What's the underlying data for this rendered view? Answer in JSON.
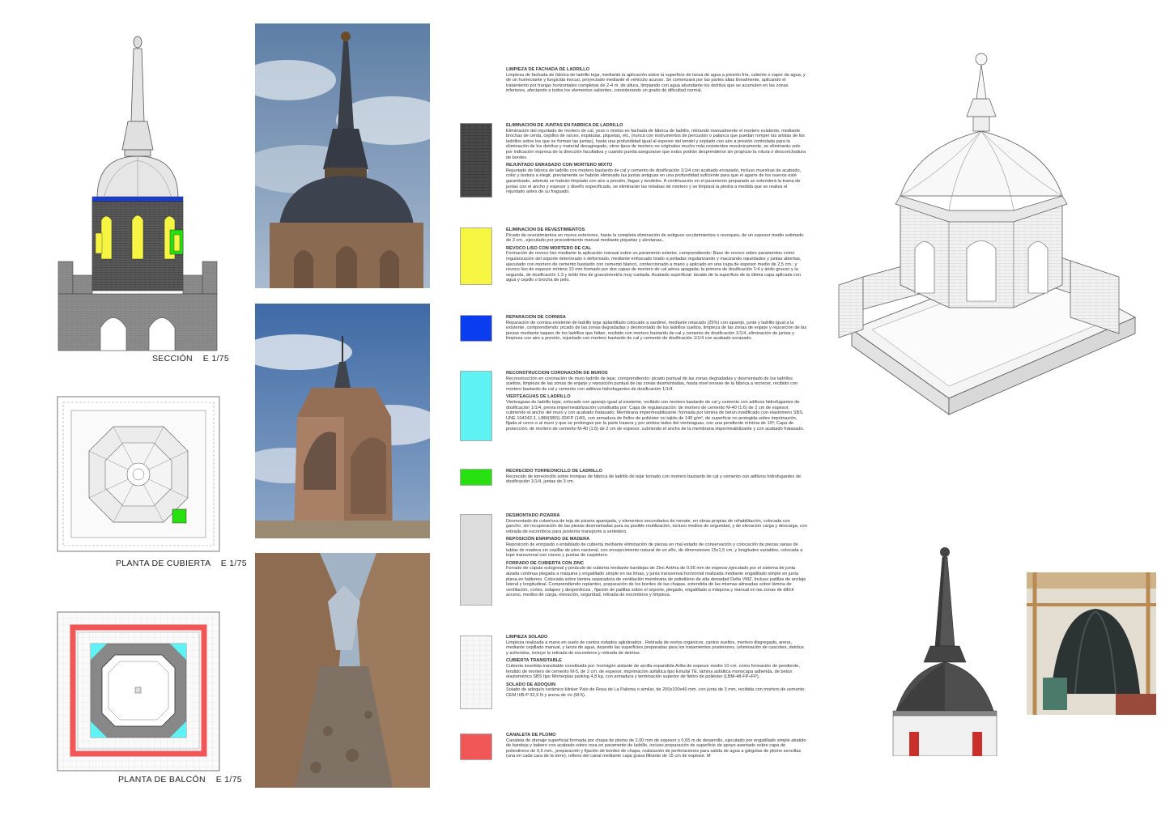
{
  "drawings": {
    "section_label": "SECCIÓN    E 1/75",
    "roof_plan_label": "PLANTA DE CUBIERTA    E 1/75",
    "balcony_plan_label": "PLANTA DE BALCÓN    E 1/75"
  },
  "legend": [
    {
      "swatch_color": "#4a4a4a",
      "swatch_pattern": "brick-dark",
      "entries": [
        {
          "title": "LIMPIEZA DE FACHADA DE LADRILLO",
          "text": "Limpieza de fachada de fábrica de ladrillo tejar, mediante la aplicación sobre la superficie de lanza de agua a presión fría, caliente o vapor de agua, y de un humectante y fungicida inocuo, proyectado mediante el vehículo acuoso. Se comenzará por las partes altas linealmente, aplicando el tratamiento por franjas horizontales completas de 2-4 m. de altura, limpiando con agua abundante los detritus que se acumulen en las zonas inferiores, afectando a todos los elementos salientes, considerando un grado de dificultad normal."
        },
        {
          "title": "ELIMINACION DE JUNTAS EN FABRICA DE LADRILLO",
          "text": "Eliminación del rejuntado de mortero de cal, yeso o mixtos en fachada de fábrica de ladrillo, retirando manualmente el mortero existente, mediante brochas de cerda, cepillos de raíces, espátulas, piquetas, etc, (nunca con instrumentos de percusión o palanca que puedan romper las aristas de los ladrillos sobre los que se forman las juntas), hasta una profundidad igual al espesor del tendel y soplado con aire a presión controlada para la eliminación de los detritus y material desagregado, otros tipos de mortero no originales mucho más resistentes mecánicamente, se eliminarán solo por indicación expresa de la dirección facultativa y cuando pueda asegurarse que estos podrán desprenderse sin propiciar la rotura o desconchadura de bordes."
        },
        {
          "title": "REJUNTADO ENRASADO CON MORTERO MIXTO",
          "text": "Rejuntado de fábrica de ladrillo con mortero bastardo de cal y cemento de dosificación 1/1/4 con acabado enrasado, incluso muestras de acabado, color y textura a elegir, previamente se habrán eliminado las juntas antiguas en una profundidad suficiente para que el agarre de los nuevos esté garantizado, además se habrán limpiado con aire a presión, llagas y tendeles. A continuación en el paramento preparado se extenderá la trama de juntas con el ancho y espesor y diseño especificado, se eliminarán las rebabas de mortero y se limpiará la piedra a medida que se realiza el rejuntado antes de su fraguado."
        }
      ]
    },
    {
      "swatch_color": "#f5f542",
      "swatch_pattern": "solid",
      "entries": [
        {
          "title": "ELIMINACION DE REVESTIMIENTOS",
          "text": "Picado de revestimientos en muros exteriores, hasta la completa eliminación de antiguos recubrimientos o revoques, de un espesor medio estimado de 3 cm., ejecutado por procedimiento manual mediante piquetas y alcotanas,."
        },
        {
          "title": "REVOCO LISO CON MORTERO DE CAL",
          "text": "Formación de revoco liso mediante la aplicación manual sobre un paramento exterior, comprendiendo: Base de revoco sobre paramentos como regularización del soporte deteriorado o deformado, mediante enfoscado tirado a pelladas regularizando y macizando oquedades y juntas abiertas, ejecutado con mortero de cemento bastardo con cemento blanco, confeccionado a mano y aplicado en una capa de espesor medio de 2,5 cm.; y revoco liso de espesor mínimo 10 mm formado por dos capas de mortero de cal aérea apagada; la primera de dosificación 1:4 y árido grueso y la segunda, de dosificación 1:3 y árido fino de granulometría muy cuidada. Acabado superficial: lavado de la superficie de la última capa aplicada con agua y cepillo o brocha de pelo."
        }
      ]
    },
    {
      "swatch_color": "#0a3cf0",
      "swatch_pattern": "solid",
      "entries": [
        {
          "title": "REPARACION DE CORNISA",
          "text": "Reparación de cornisa existente de ladrillo tejar aplantillado colocado a sardinel, mediante retacado (25%) con aparejo, junta y ladrillo igual a la existente, comprendiendo: picado de las zonas degradadas y desmontado de los ladrillos sueltos, limpieza de las zonas de enjarje y reposición de las piezas mediante taqueo de los ladrillos que faltan, recibido con mortero bastardo de cal y cemento de dosificación 1/1/4, eliminación de juntas y limpieza con aire a presión, rejuntado con mortero bastardo de cal y cemento de dosificación 1/1/4 con acabado enrasado."
        }
      ]
    },
    {
      "swatch_color": "#5ef2f5",
      "swatch_pattern": "solid",
      "entries": [
        {
          "title": "RECONSTRUCCION CORONACIÓN DE MUROS",
          "text": "Reconstrucción en coronación de muro ladrillo de tejar, comprendiendo: picado puntual de las zonas degradadas y desmontado de los ladrillos sueltos, limpieza de las zonas de enjarje y reposición puntual de las zonas desmontadas, hasta nivel enrase de la fábrica a recrecer, recibido con mortero bastardo de cal y cemento con aditivos hidrofugantes de dosificación 1/1/4."
        },
        {
          "title": "VIERTEAGUAS DE LADRILLO",
          "text": "Vierteaguas de ladrillo tejar, colocado con aparejo igual al existente, recibido con mortero bastardo de cal y cemento con aditivos hidrofugantes de dosificación 1/1/4, previa impermeabilización constituida por: Capa de regularización: de mortero de cemento M-40 (1:6) de 2 cm de espesor, cubriendo el ancho del muro y con acabado fratasado; Membrana impermeabilizante: formada por lámina de betún modificado con elastómero SBS, UNE 104242-1, LBM(SBS)-30/FP (140), con armadura de fieltro de poliéster no tejido de 140 g/m², de superficie no protegida sobre imprimación, fijada al cerco o al muro y que se prolongue por la parte trasera y por ambos lados del vierteaguas, con una pendiente mínima de 10º; Capa de protección: de mortero de cemento M-40 (1:6) de 2 cm de espesor, cubriendo el ancho de la membrana impermeabilizante y con acabado fratasado."
        }
      ]
    },
    {
      "swatch_color": "#28e010",
      "swatch_pattern": "solid",
      "entries": [
        {
          "title": "RECRECIDO TORREONCILLO DE LADRILLO",
          "text": "Recrecido de torreoncillo sobre trompas de fábrica de ladrillo de tejar tomado con mortero bastardo de cal y cemento con aditivos hidrofugantes de dosificación 1/1/4, juntas de 3 cm."
        }
      ]
    },
    {
      "swatch_color": "#dcdcdc",
      "swatch_pattern": "solid",
      "entries": [
        {
          "title": "DESMONTADO PIZARRA",
          "text": "Desmontado de cobertura de teja de pizarra aparejada, y elementos secundarios de remate, en obras propias de rehabilitación, colocada con gancho, sin recuperación de las piezas desmontadas para su posible reutilización, incluso medios de seguridad, y de elevación carga y descarga, con retirada de escombros para posterior transporte a vertedero."
        },
        {
          "title": "REPOSICIÓN ENRIPIADO DE MADERA",
          "text": "Reposición de enripiado o entablado de cubierta mediante eliminación de piezas en mal estado de conservación y colocación de piezas sanas de tablas de madera sin cepillar de pino nacional, con envejecimiento natural de un año, de dimensiones 15x1,5 cm, y longitudes variables, colocada a tope transversal con clavos y puntas de carpintero."
        },
        {
          "title": "FORRADO DE CUBIERTA CON ZINC",
          "text": "Forrado de cúpula octogonal y pináculo de cubierta mediante bandejas de Zinc Anthra de 0.65 mm de espesor,ejecutado por el sistema de junta alzada continua plegada a máquina y engatillado simple en las limas, y junta transversal horizontal realizada mediante engatillado simple en junta plana en faldones. Colocada sobre lámina separadora de ventilación membrana de polietileno de alta densidad Delta VMZ. Incluso patillas de anclaje lateral y longitudinal. Comprendiendo replanteo, preparación de los bordes de las chapas, extendida de las mismas alineadas sobre lámina de ventilación, cortes, solapes y desperdicios , fijación de patillas sobre el soporte, plegado, engatillado a máquina y manual en las zonas de difícil acceso, medios de carga, elevación, seguridad, retirada de escombros y limpieza."
        }
      ]
    },
    {
      "swatch_color": "#f6f6f6",
      "swatch_pattern": "tile-light",
      "entries": [
        {
          "title": "LIMPIEZA SOLADO",
          "text": "Limpieza realizada a mano en suelo de cantos rodados aglutinados . Retirada de restos orgánicos, cantos sueltos, mortero disgregado, arena, mediante cepillado manual, y lanza de agua, dejando las superficies preparadas para los tratamientos posteriores, (eliminación de cascotes, detritus y acheridos, incluye la retirada de escombros y retirada de detritus."
        },
        {
          "title": "CUBIERTA TRANSITABLE",
          "text": "Cubierta invertida transitable constituida por: hormigón aislante de arcilla expandida Arlita de espesor medio 10 cm. como formación de pendiente, tendido de mortero de cemento M-5, de 2 cm. de espesor, imprimación asfáltica tipo Emufal TE, lámina asfáltica monocapa adherida, de betún elastomérico SBS tipo Morterplas parking 4,8 kg. con armadura y terminación superior de fieltro de poliéster (LBM-48-FP+FP)."
        },
        {
          "title": "SOLADO DE ADOQUIN",
          "text": "Solado de adoquín cerámico klinker Palo de Rosa de La Paloma o similar, de 200x100x40 mm. con junta de 3 mm, recibida con mortero de cemento CEM II/B-P 32,5 N y arena de río (M-5)."
        }
      ]
    },
    {
      "swatch_color": "#f25757",
      "swatch_pattern": "solid",
      "entries": [
        {
          "title": "CANALETA DE PLOMO",
          "text": "Canaleta de drenaje superficial formada por chapa de plomo de 2,00 mm de espesor y 0,65 m de desarrollo, ejecutado por engatillado simple abatido de bandeja y babero con acabado sobre roza en paramento de ladrillo, incluso preparación de superficie de apoyo asentado sobre capa de poliestireno de 0,5 mm., preparación y fijación de bordes de chapa, realización de perforaciones para salida de agua a gárgolas de plomo sencillas (una en cada cara de la torre), relleno del canal mediante capa grava filtrante de 15 cm de espesor. M"
        }
      ]
    }
  ]
}
